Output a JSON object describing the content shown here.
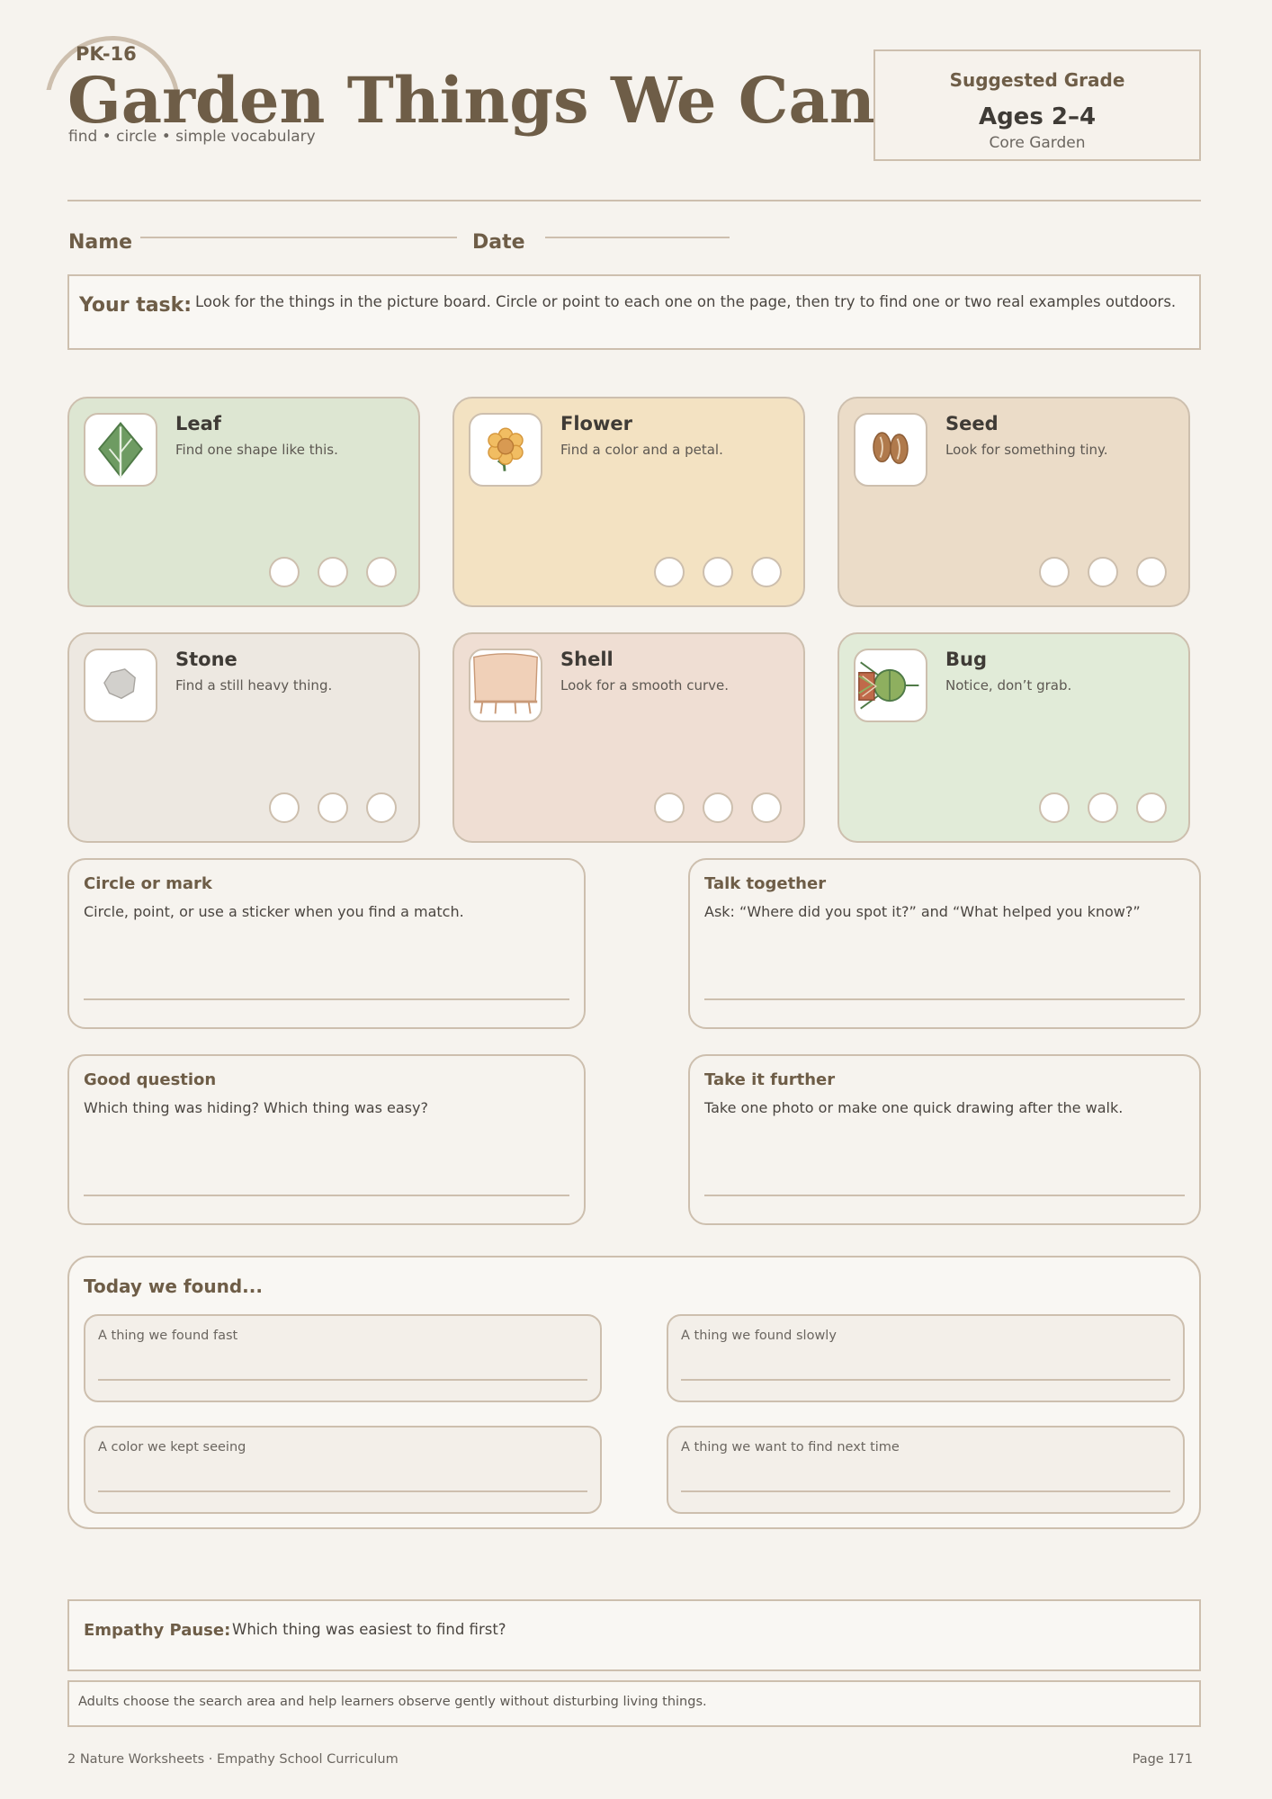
{
  "header": {
    "code": "PK-16",
    "title": "Garden Things We Can Find",
    "subtitle": "find • circle • simple vocabulary"
  },
  "grade": {
    "label": "Suggested Grade",
    "ages": "Ages 2–4",
    "track": "Core Garden"
  },
  "form": {
    "name_label": "Name",
    "date_label": "Date"
  },
  "task": {
    "label": "Your task:",
    "text": "Look for the things in the picture board. Circle or point to each one on the page, then try to find one or two real examples outdoors."
  },
  "cards": [
    {
      "name": "Leaf",
      "desc": "Find one shape like this.",
      "icon": "leaf-icon",
      "bg": "#dde6d2"
    },
    {
      "name": "Flower",
      "desc": "Find a color and a petal.",
      "icon": "flower-icon",
      "bg": "#f3e2c2"
    },
    {
      "name": "Seed",
      "desc": "Look for something tiny.",
      "icon": "seed-icon",
      "bg": "#ebdcc8"
    },
    {
      "name": "Stone",
      "desc": "Find a still heavy thing.",
      "icon": "stone-icon",
      "bg": "#ede8e1"
    },
    {
      "name": "Shell",
      "desc": "Look for a smooth curve.",
      "icon": "shell-icon",
      "bg": "#efded3"
    },
    {
      "name": "Bug",
      "desc": "Notice, don’t grab.",
      "icon": "bug-icon",
      "bg": "#e1ebd8"
    }
  ],
  "boxes": [
    {
      "title": "Circle or mark",
      "text": "Circle, point, or use a sticker when you find a match."
    },
    {
      "title": "Talk together",
      "text": "Ask: “Where did you spot it?” and “What helped you know?”"
    },
    {
      "title": "Good question",
      "text": "Which thing was hiding? Which thing was easy?"
    },
    {
      "title": "Take it further",
      "text": "Take one photo or make one quick drawing after the walk."
    }
  ],
  "found": {
    "title": "Today we found...",
    "prompts": [
      "A thing we found fast",
      "A thing we found slowly",
      "A color we kept seeing",
      "A thing we want to find next time"
    ]
  },
  "empathy": {
    "label": "Empathy Pause:",
    "text": "Which thing was easiest to find first?"
  },
  "note": "Adults choose the search area and help learners observe gently without disturbing living things.",
  "footer": {
    "left": "2 Nature Worksheets · Empathy School Curriculum",
    "right": "Page 171"
  }
}
